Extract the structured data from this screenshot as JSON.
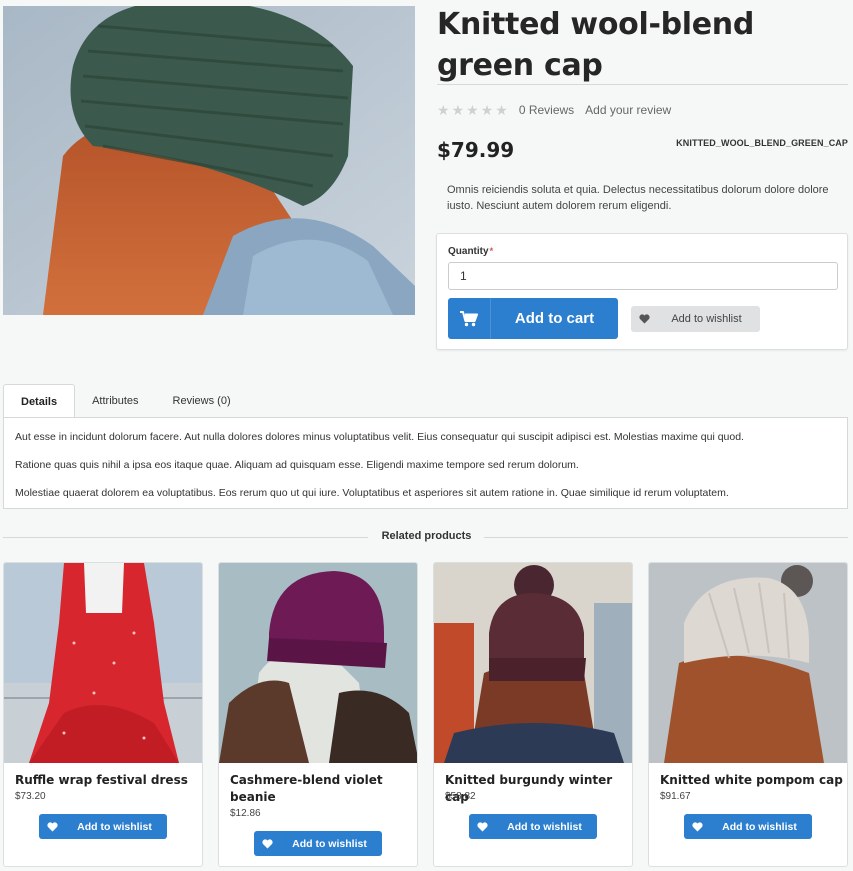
{
  "product": {
    "title": "Knitted wool-blend green cap",
    "reviews_count": "0 Reviews",
    "add_review": "Add your review",
    "price": "$79.99",
    "sku": "KNITTED_WOOL_BLEND_GREEN_CAP",
    "short_description": "Omnis reiciendis soluta et quia. Delectus necessitatibus dolorum dolore dolore iusto. Nesciunt autem dolorem rerum eligendi.",
    "rating_stars": 0,
    "rating_max": 5
  },
  "cart": {
    "quantity_label": "Quantity",
    "required_mark": "*",
    "quantity_value": "1",
    "add_to_cart": "Add to cart",
    "add_to_wishlist": "Add to wishlist"
  },
  "tabs": [
    {
      "label": "Details",
      "active": true
    },
    {
      "label": "Attributes",
      "active": false
    },
    {
      "label": "Reviews (0)",
      "active": false
    }
  ],
  "details": [
    "Aut esse in incidunt dolorum facere. Aut nulla dolores dolores minus voluptatibus velit. Eius consequatur qui suscipit adipisci est. Molestias maxime qui quod.",
    "Ratione quas quis nihil a ipsa eos itaque quae. Aliquam ad quisquam esse. Eligendi maxime tempore sed rerum dolorum.",
    "Molestiae quaerat dolorem ea voluptatibus. Eos rerum quo ut qui iure. Voluptatibus et asperiores sit autem ratione in. Quae similique id rerum voluptatem."
  ],
  "related": {
    "title": "Related products",
    "items": [
      {
        "name": "Ruffle wrap festival dress",
        "price": "$73.20",
        "wishlist": "Add to wishlist"
      },
      {
        "name": "Cashmere-blend violet beanie",
        "price": "$12.86",
        "wishlist": "Add to wishlist"
      },
      {
        "name": "Knitted burgundy winter cap",
        "price": "$58.82",
        "wishlist": "Add to wishlist"
      },
      {
        "name": "Knitted white pompom cap",
        "price": "$91.67",
        "wishlist": "Add to wishlist"
      }
    ]
  },
  "colors": {
    "primary": "#2b7fce",
    "background": "#f6f8f8",
    "star_empty": "#d0d0d0",
    "required": "#d9534f"
  },
  "icons": [
    "cart-icon",
    "heart-icon",
    "star-icon"
  ]
}
